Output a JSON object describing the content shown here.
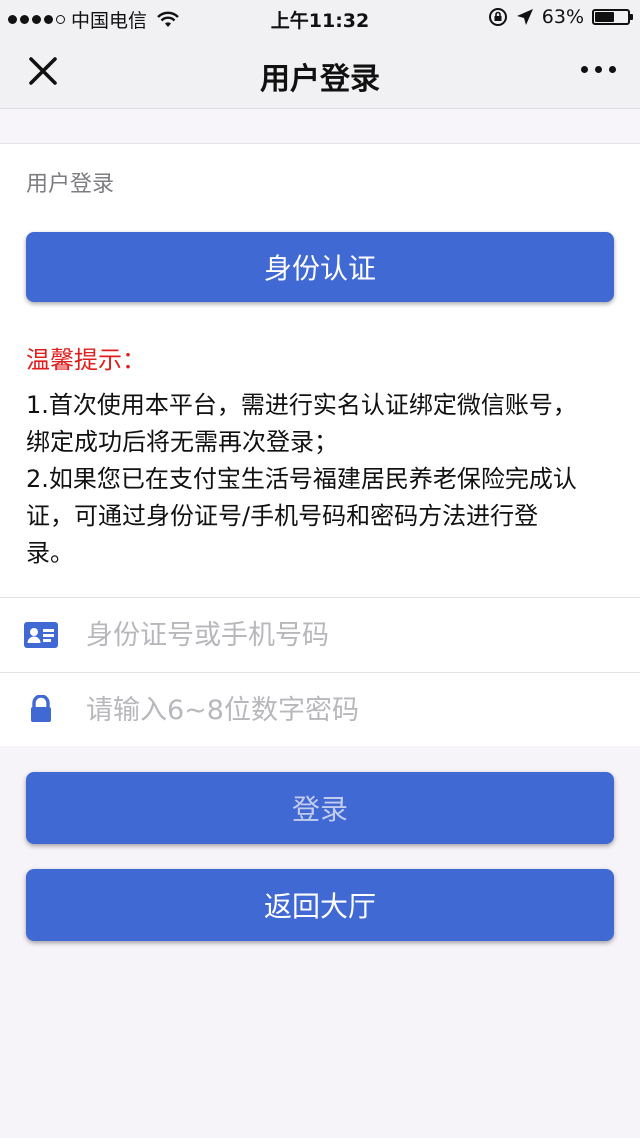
{
  "status_bar": {
    "carrier": "中国电信",
    "time": "上午11:32",
    "battery": "63%",
    "battery_level": 0.63
  },
  "nav": {
    "title": "用户登录"
  },
  "section": {
    "title": "用户登录"
  },
  "auth_button": "身份认证",
  "tips": {
    "heading": "温馨提示：",
    "lines": [
      "1.首次使用本平台，需进行实名认证绑定微信账号，",
      "绑定成功后将无需再次登录；",
      "2.如果您已在支付宝生活号福建居民养老保险完成认",
      "证，可通过身份证号/手机号码和密码方法进行登",
      "录。"
    ]
  },
  "fields": {
    "id_placeholder": "身份证号或手机号码",
    "password_placeholder": "请输入6~8位数字密码"
  },
  "buttons": {
    "login": "登录",
    "back": "返回大厅"
  },
  "colors": {
    "primary": "#4169d3",
    "tip_heading": "#e01e1e"
  }
}
